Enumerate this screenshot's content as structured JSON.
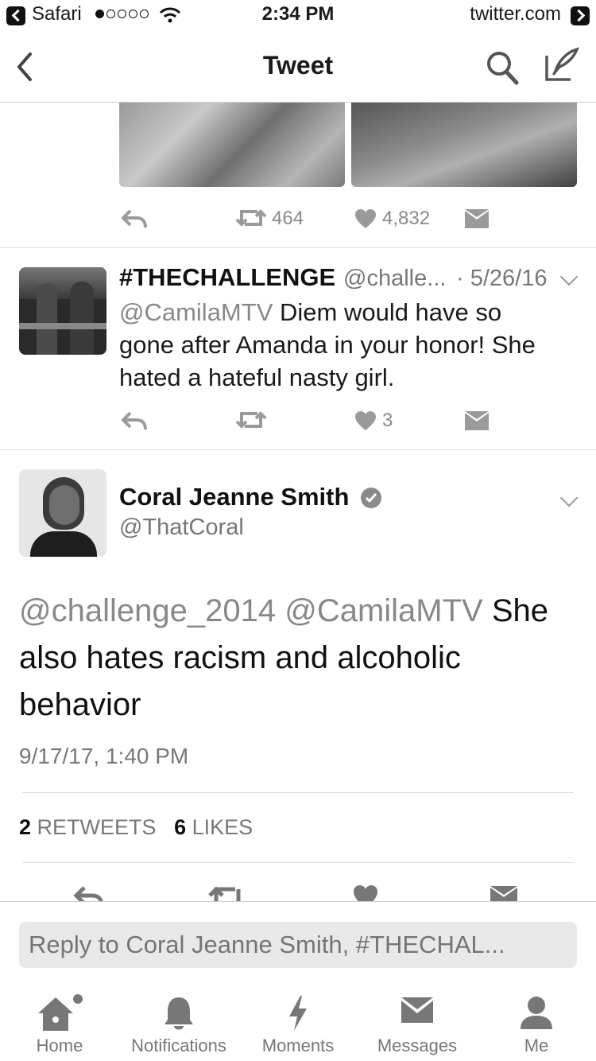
{
  "status_bar": {
    "app": "Safari",
    "time": "2:34 PM",
    "site": "twitter.com"
  },
  "nav": {
    "title": "Tweet"
  },
  "prev_tweet_actions": {
    "retweets": "464",
    "likes": "4,832"
  },
  "reply_tweet": {
    "name": "#THECHALLENGE",
    "handle": "@challe...",
    "date": "· 5/26/16",
    "mention": "@CamilaMTV",
    "text_line1": "Diem would have so",
    "text_line2": "gone after Amanda in your honor! She",
    "text_line3": "hated a hateful nasty girl.",
    "likes": "3"
  },
  "main_tweet": {
    "name": "Coral Jeanne Smith",
    "handle": "@ThatCoral",
    "mention1": "@challenge_2014",
    "mention2": "@CamilaMTV",
    "text_line1_tail": "She",
    "text_line2": "also hates racism and alcoholic",
    "text_line3": "behavior",
    "timestamp": "9/17/17, 1:40 PM",
    "retweet_count": "2",
    "retweet_label": "RETWEETS",
    "like_count": "6",
    "like_label": "LIKES"
  },
  "reply_box": {
    "placeholder": "Reply to Coral Jeanne Smith, #THECHAL..."
  },
  "tabs": [
    {
      "label": "Home",
      "icon": "home-icon"
    },
    {
      "label": "Notifications",
      "icon": "bell-icon"
    },
    {
      "label": "Moments",
      "icon": "lightning-icon"
    },
    {
      "label": "Messages",
      "icon": "envelope-icon"
    },
    {
      "label": "Me",
      "icon": "person-icon"
    }
  ]
}
